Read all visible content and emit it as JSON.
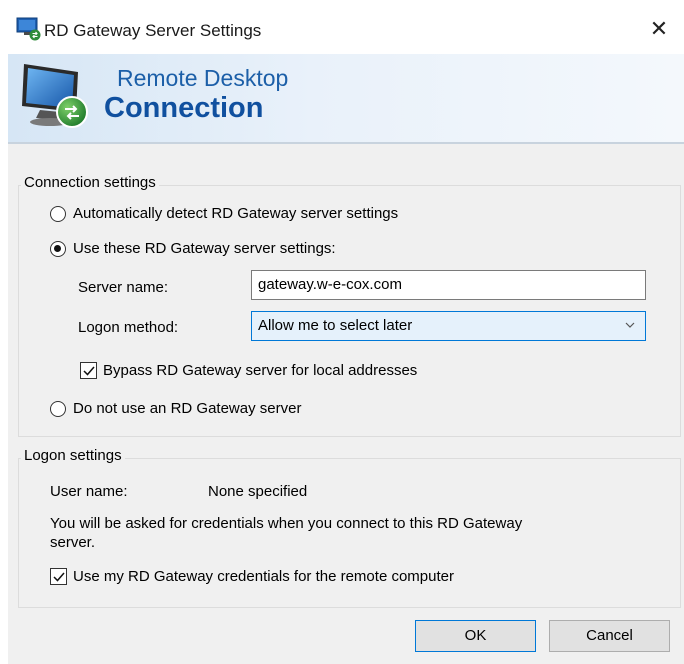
{
  "window": {
    "title": "RD Gateway Server Settings",
    "close_glyph": "✕"
  },
  "banner": {
    "line1": "Remote Desktop",
    "line2": "Connection"
  },
  "connection_settings": {
    "legend": "Connection settings",
    "auto_detect_label": "Automatically detect RD Gateway server settings",
    "auto_detect_selected": false,
    "use_these_label": "Use these RD Gateway server settings:",
    "use_these_selected": true,
    "server_name_label": "Server name:",
    "server_name_value": "gateway.w-e-cox.com",
    "logon_method_label": "Logon method:",
    "logon_method_value": "Allow me to select later",
    "bypass_label": "Bypass RD Gateway server for local addresses",
    "bypass_checked": true,
    "do_not_use_label": "Do not use an RD Gateway server",
    "do_not_use_selected": false
  },
  "logon_settings": {
    "legend": "Logon settings",
    "user_name_label": "User name:",
    "user_name_value": "None specified",
    "info_line1": "You will be asked for credentials when you connect to this RD Gateway",
    "info_line2": "server.",
    "use_credentials_label": "Use my RD Gateway credentials for the remote computer",
    "use_credentials_checked": true
  },
  "buttons": {
    "ok": "OK",
    "cancel": "Cancel"
  },
  "colors": {
    "accent": "#0078d7",
    "brand": "#1c5fa8",
    "dialog_bg": "#f0f0f0"
  },
  "icons": {
    "title": "remote-desktop-icon",
    "logo": "remote-desktop-logo-icon",
    "dropdown": "chevron-down-icon"
  }
}
